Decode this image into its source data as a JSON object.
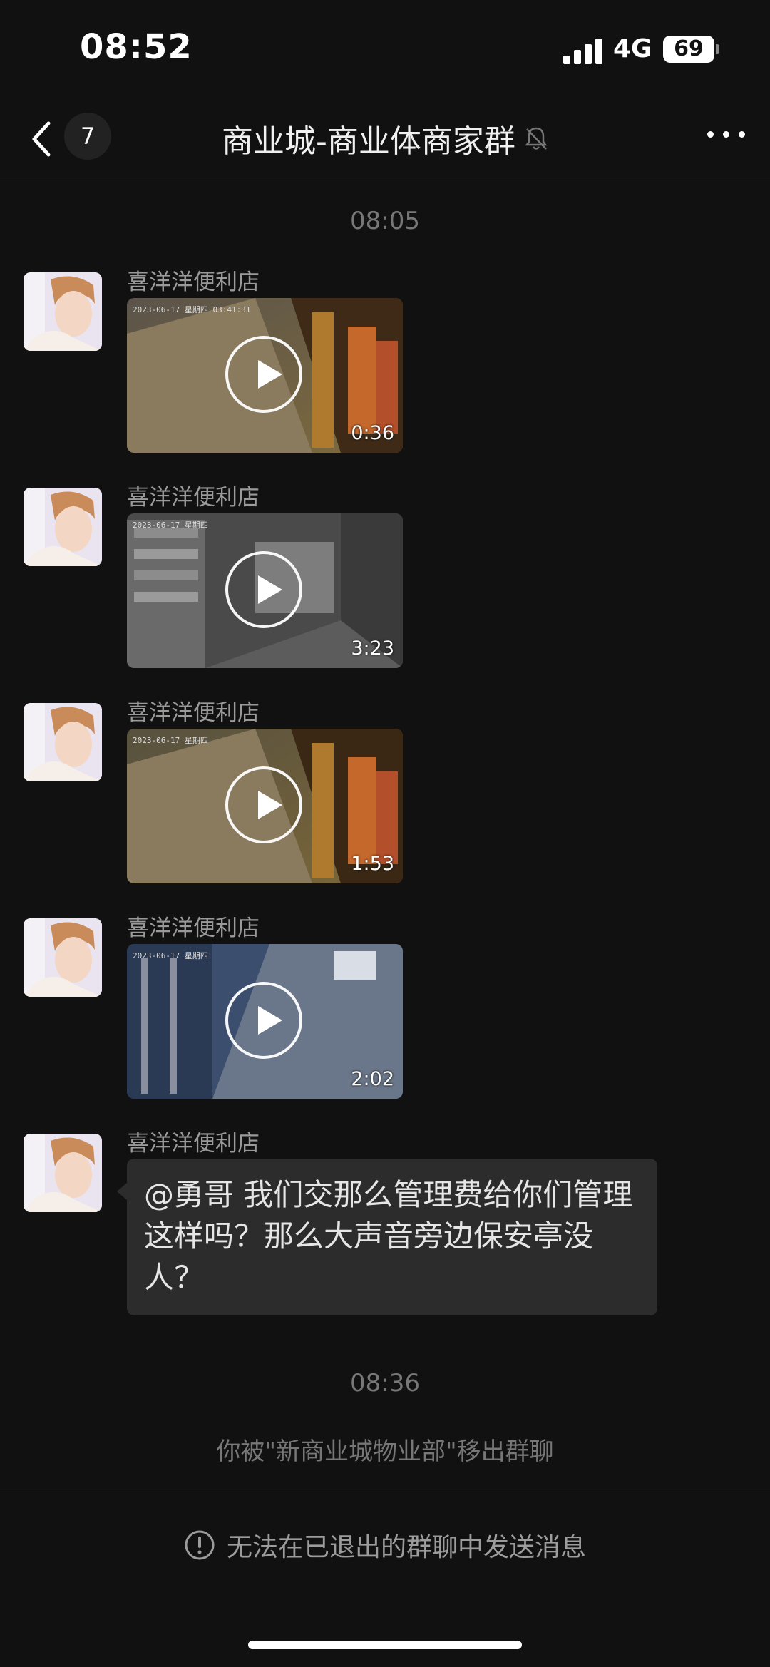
{
  "status_bar": {
    "time": "08:52",
    "network": "4G",
    "battery": "69"
  },
  "header": {
    "unread_count": "7",
    "title": "商业城-商业体商家群"
  },
  "timestamps": {
    "first": "08:05",
    "second": "08:36"
  },
  "messages": [
    {
      "sender": "喜洋洋便利店",
      "type": "video",
      "duration": "0:36"
    },
    {
      "sender": "喜洋洋便利店",
      "type": "video",
      "duration": "3:23"
    },
    {
      "sender": "喜洋洋便利店",
      "type": "video",
      "duration": "1:53"
    },
    {
      "sender": "喜洋洋便利店",
      "type": "video",
      "duration": "2:02"
    },
    {
      "sender": "喜洋洋便利店",
      "type": "text",
      "text": "@勇哥 我们交那么管理费给你们管理这样吗？那么大声音旁边保安亭没人？"
    }
  ],
  "system_message": "你被\"新商业城物业部\"移出群聊",
  "footer": {
    "notice": "无法在已退出的群聊中发送消息"
  },
  "icons": [
    "back-chevron-icon",
    "mute-bell-icon",
    "more-icon",
    "play-icon",
    "warning-icon"
  ],
  "colors": {
    "background": "#111111",
    "bubble": "#2c2c2c",
    "muted_text": "#777777"
  }
}
